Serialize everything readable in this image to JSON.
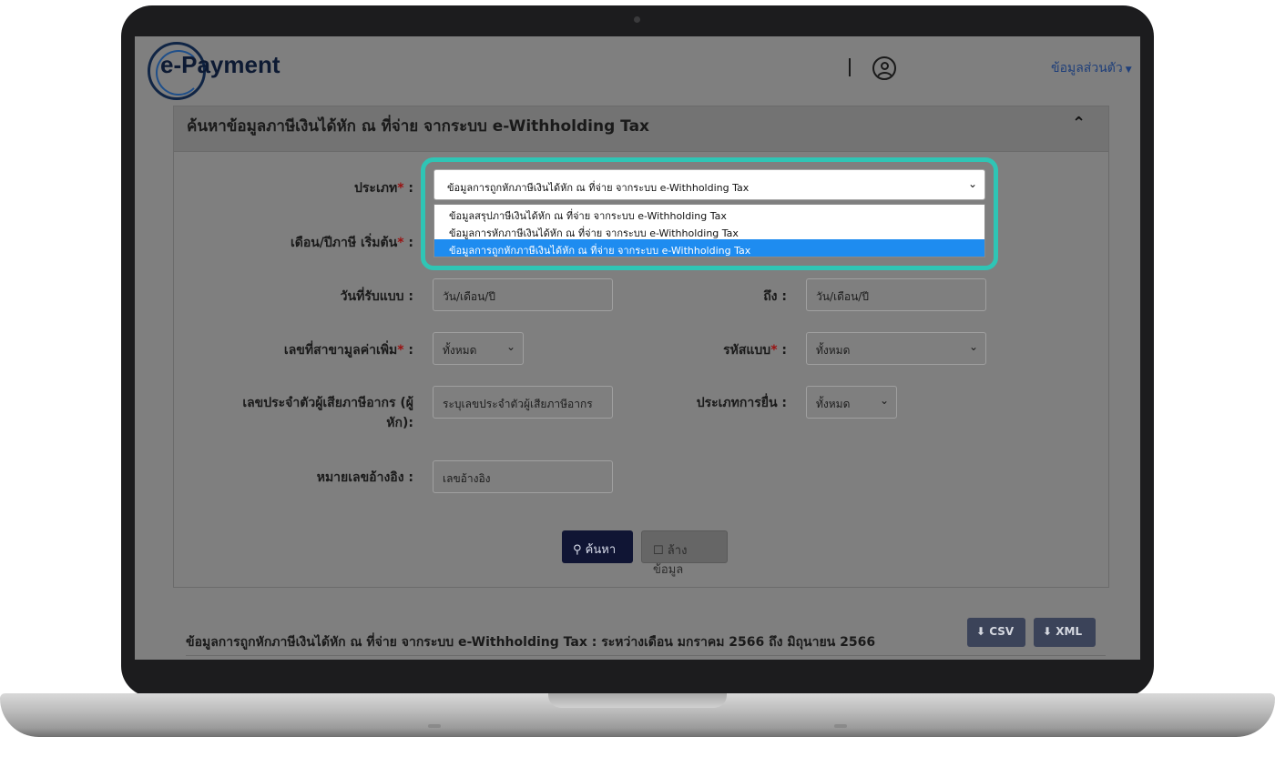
{
  "header": {
    "logo_text": "e-Payment",
    "profile_menu_label": "ข้อมูลส่วนตัว"
  },
  "panel": {
    "title": "ค้นหาข้อมูลภาษีเงินได้หัก ณ ที่จ่าย จากระบบ e-Withholding Tax"
  },
  "form": {
    "type_label": "ประเภท",
    "type_value": "ข้อมูลการถูกหักภาษีเงินได้หัก ณ ที่จ่าย จากระบบ e-Withholding Tax",
    "type_options": [
      "ข้อมูลสรุปภาษีเงินได้หัก ณ ที่จ่าย จากระบบ e-Withholding Tax",
      "ข้อมูลการหักภาษีเงินได้หัก ณ ที่จ่าย จากระบบ e-Withholding Tax",
      "ข้อมูลการถูกหักภาษีเงินได้หัก ณ ที่จ่าย จากระบบ e-Withholding Tax"
    ],
    "start_month_label": "เดือน/ปีภาษี เริ่มต้น",
    "receive_date_label": "วันที่รับแบบ :",
    "receive_date_placeholder": "วัน/เดือน/ปี",
    "to_label": "ถึง :",
    "to_placeholder": "วัน/เดือน/ปี",
    "vat_branch_label": "เลขที่สาขามูลค่าเพิ่ม",
    "vat_branch_value": "ทั้งหมด",
    "form_code_label": "รหัสแบบ",
    "form_code_value": "ทั้งหมด",
    "taxpayer_id_label": "เลขประจำตัวผู้เสียภาษีอากร (ผู้หัก):",
    "taxpayer_id_placeholder": "ระบุเลขประจำตัวผู้เสียภาษีอากร",
    "filing_type_label": "ประเภทการยื่น :",
    "filing_type_value": "ทั้งหมด",
    "reference_label": "หมายเลขอ้างอิง :",
    "reference_placeholder": "เลขอ้างอิง",
    "colon": ":",
    "required_mark": "*"
  },
  "buttons": {
    "search_label": "ค้นหา",
    "clear_label": "ล้างข้อมูล",
    "csv_label": "CSV",
    "xml_label": "XML"
  },
  "results": {
    "title": "ข้อมูลการถูกหักภาษีเงินได้หัก ณ ที่จ่าย จากระบบ e-Withholding Tax : ระหว่างเดือน มกราคม 2566 ถึง มิถุนายน 2566"
  },
  "colors": {
    "highlight_frame": "#2fc5b5",
    "selected_option": "#1e8cf0",
    "search_button": "#101534",
    "export_button": "#3b4359"
  }
}
